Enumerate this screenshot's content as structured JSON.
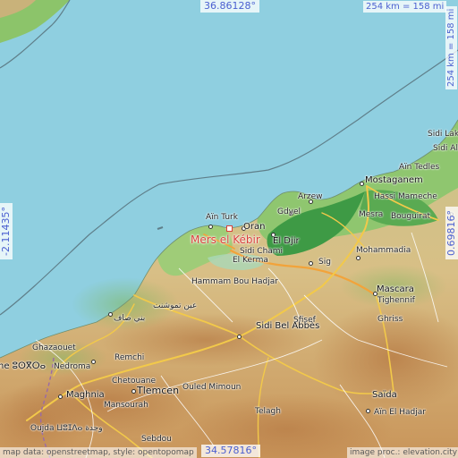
{
  "map": {
    "highlight_place": "Mers el Kébir",
    "coords": {
      "top_lat": "36.86128°",
      "bottom_lat": "34.57816°",
      "left_lon": "-2.11435°",
      "right_lon": "0.69816°"
    },
    "scale": {
      "top": "254 km = 158 mi",
      "right": "254 km = 158 mi"
    },
    "credits": {
      "left": "map data: openstreetmap, style: opentopomap",
      "right": "image proc.: elevation.city"
    },
    "places": {
      "mostaganem": "Mostaganem",
      "sidi_lakhdar": "Sidi Lakh",
      "sidi_ali": "Sidi Ali",
      "ain_tedles": "Aïn Tedles",
      "hassi_mameche": "Hassi Mameche",
      "arzew": "Arzew",
      "gdyel": "Gdyel",
      "mesra": "Mesra",
      "bouguirat": "Bouguirat",
      "ain_turk": "Aïn Turk",
      "oran": "Oran",
      "el_djir": "El Djir",
      "sidi_chami": "Sidi Chami",
      "el_kerma": "El Kerma",
      "mohammadia": "Mohammadia",
      "sig": "Sig",
      "hammam_bou_hadjar": "Hammam Bou Hadjar",
      "ain_temouchent_ar": "عين تموشنت",
      "beni_saf_ar": "بني صاف",
      "mascara": "Mascara",
      "tighennif": "Tighennif",
      "sfisef": "Sfisef",
      "ghriss": "Ghriss",
      "sidi_bel_abbes": "Sidi Bel Abbès",
      "ghazaouet": "Ghazaouet",
      "nedroma": "Nedroma",
      "remchi": "Remchi",
      "ne_partial": "ne ⵓⵙⴳⵔⴰ",
      "chetouane": "Chetouane",
      "maghnia": "Maghnia",
      "tlemcen": "Tlemcen",
      "ouled_mimoun": "Ouled Mimoun",
      "mansourah": "Mansourah",
      "saida": "Saïda",
      "ain_el_hadjar": "Aïn El Hadjar",
      "telagh": "Telagh",
      "oujda": "Oujda ⵡⵓⵊⴷⴰ وجدة",
      "sebdou": "Sebdou",
      "r_partial": "R"
    }
  }
}
